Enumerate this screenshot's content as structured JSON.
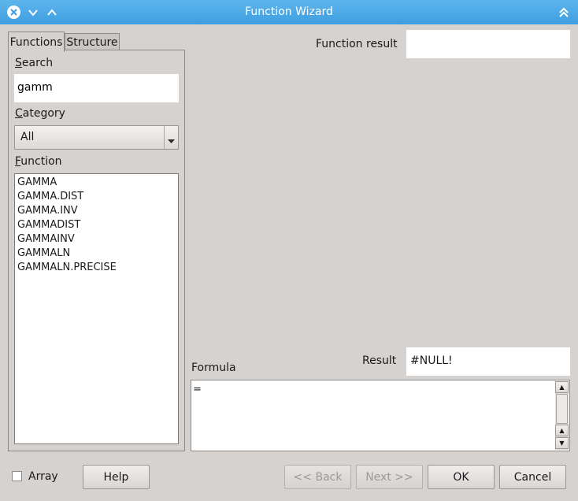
{
  "window": {
    "title": "Function Wizard"
  },
  "tabs": [
    {
      "label": "Functions",
      "active": true
    },
    {
      "label": "Structure",
      "active": false
    }
  ],
  "search": {
    "label": "Search",
    "value": "gamm"
  },
  "category": {
    "label": "Category",
    "selected": "All"
  },
  "function_list": {
    "label": "Function",
    "items": [
      "GAMMA",
      "GAMMA.DIST",
      "GAMMA.INV",
      "GAMMADIST",
      "GAMMAINV",
      "GAMMALN",
      "GAMMALN.PRECISE"
    ]
  },
  "function_result": {
    "label": "Function result",
    "value": ""
  },
  "result": {
    "label": "Result",
    "value": "#NULL!"
  },
  "formula": {
    "label": "Formula",
    "value": "="
  },
  "array": {
    "label": "Array",
    "checked": false
  },
  "buttons": {
    "help": "Help",
    "back": "<< Back",
    "next": "Next >>",
    "ok": "OK",
    "cancel": "Cancel"
  },
  "colors": {
    "titlebar": "#3d9ee0",
    "background": "#d6d2d0"
  }
}
